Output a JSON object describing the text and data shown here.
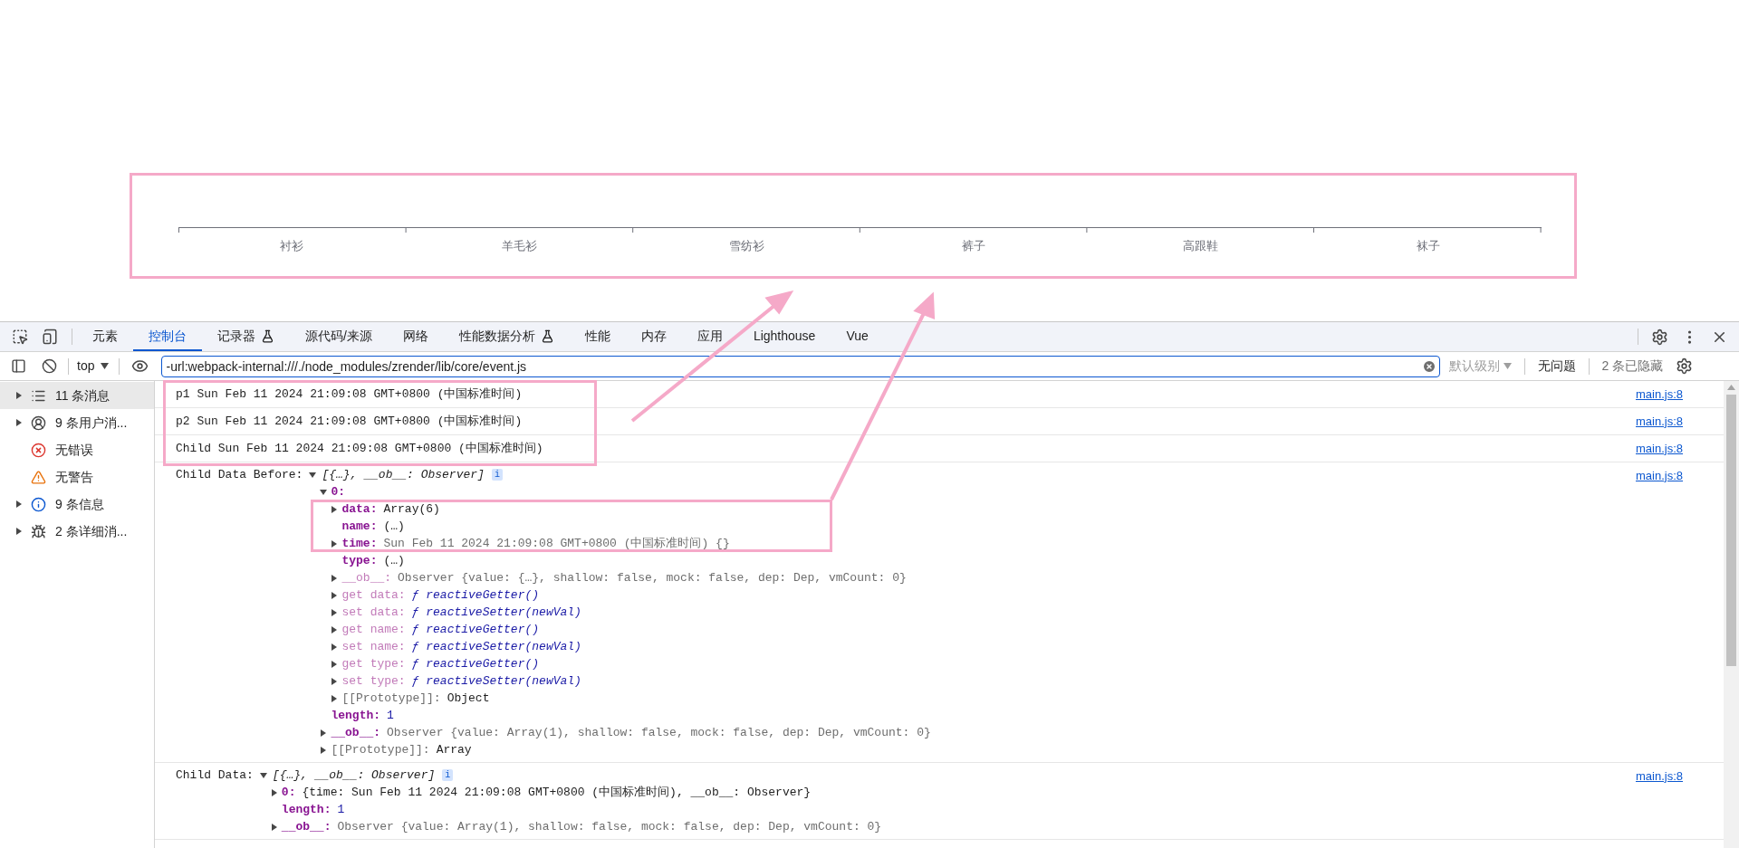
{
  "page": {
    "chart": {
      "categories": [
        "衬衫",
        "羊毛衫",
        "雪纺衫",
        "裤子",
        "高跟鞋",
        "袜子"
      ]
    }
  },
  "devtools": {
    "tabs": [
      {
        "label": "元素",
        "selected": false,
        "experimental": false
      },
      {
        "label": "控制台",
        "selected": true,
        "experimental": false
      },
      {
        "label": "记录器",
        "selected": false,
        "experimental": true
      },
      {
        "label": "源代码/来源",
        "selected": false,
        "experimental": false
      },
      {
        "label": "网络",
        "selected": false,
        "experimental": false
      },
      {
        "label": "性能数据分析",
        "selected": false,
        "experimental": true
      },
      {
        "label": "性能",
        "selected": false,
        "experimental": false
      },
      {
        "label": "内存",
        "selected": false,
        "experimental": false
      },
      {
        "label": "应用",
        "selected": false,
        "experimental": false
      },
      {
        "label": "Lighthouse",
        "selected": false,
        "experimental": false
      },
      {
        "label": "Vue",
        "selected": false,
        "experimental": false
      }
    ],
    "toolbar": {
      "context": "top",
      "filter": {
        "value": "-url:webpack-internal:///./node_modules/zrender/lib/core/event.js"
      },
      "level": "默认级别",
      "issues": "无问题",
      "hidden": "2 条已隐藏"
    },
    "sidebar": [
      {
        "label": "11 条消息",
        "kind": "messages",
        "expandable": true,
        "selected": true
      },
      {
        "label": "9 条用户消...",
        "kind": "user",
        "expandable": true,
        "selected": false
      },
      {
        "label": "无错误",
        "kind": "error",
        "expandable": false,
        "selected": false
      },
      {
        "label": "无警告",
        "kind": "warning",
        "expandable": false,
        "selected": false
      },
      {
        "label": "9 条信息",
        "kind": "info",
        "expandable": true,
        "selected": false
      },
      {
        "label": "2 条详细消...",
        "kind": "verbose",
        "expandable": true,
        "selected": false
      }
    ],
    "messages": [
      {
        "kind": "text",
        "text": "p1 Sun Feb 11 2024 21:09:08 GMT+0800 (中国标准时间)",
        "source": "main.js:8"
      },
      {
        "kind": "text",
        "text": "p2 Sun Feb 11 2024 21:09:08 GMT+0800 (中国标准时间)",
        "source": "main.js:8"
      },
      {
        "kind": "text",
        "text": "Child Sun Feb 11 2024 21:09:08 GMT+0800 (中国标准时间)",
        "source": "main.js:8"
      },
      {
        "kind": "object",
        "label": "Child Data Before:",
        "summary": "[{…}, __ob__: Observer]",
        "badge": "i",
        "expanded": true,
        "source": "main.js:8",
        "children": [
          {
            "key": "0:",
            "enumerable": true,
            "internal": false,
            "expandable": true,
            "expanded": true,
            "children": [
              {
                "kind": "text",
                "key": "data:",
                "enumerable": true,
                "internal": false,
                "value": "Array(6)",
                "expandable": true,
                "expanded": false
              },
              {
                "kind": "text",
                "key": "name:",
                "enumerable": true,
                "internal": false,
                "value": "(…)",
                "expandable": false
              },
              {
                "kind": "preview",
                "key": "time:",
                "enumerable": true,
                "internal": false,
                "value": "Sun Feb 11 2024 21:09:08 GMT+0800 (中国标准时间) {}",
                "expandable": true,
                "expanded": false
              },
              {
                "kind": "text",
                "key": "type:",
                "enumerable": true,
                "internal": false,
                "value": "(…)",
                "expandable": false
              },
              {
                "kind": "preview",
                "key": "__ob__:",
                "enumerable": false,
                "internal": false,
                "value": "Observer {value: {…}, shallow: false, mock: false, dep: Dep, vmCount: 0}",
                "expandable": true,
                "expanded": false
              },
              {
                "kind": "function",
                "key": "get data:",
                "enumerable": false,
                "internal": false,
                "value": "ƒ reactiveGetter()",
                "expandable": true,
                "expanded": false
              },
              {
                "kind": "function",
                "key": "set data:",
                "enumerable": false,
                "internal": false,
                "value": "ƒ reactiveSetter(newVal)",
                "expandable": true,
                "expanded": false
              },
              {
                "kind": "function",
                "key": "get name:",
                "enumerable": false,
                "internal": false,
                "value": "ƒ reactiveGetter()",
                "expandable": true,
                "expanded": false
              },
              {
                "kind": "function",
                "key": "set name:",
                "enumerable": false,
                "internal": false,
                "value": "ƒ reactiveSetter(newVal)",
                "expandable": true,
                "expanded": false
              },
              {
                "kind": "function",
                "key": "get type:",
                "enumerable": false,
                "internal": false,
                "value": "ƒ reactiveGetter()",
                "expandable": true,
                "expanded": false
              },
              {
                "kind": "function",
                "key": "set type:",
                "enumerable": false,
                "internal": false,
                "value": "ƒ reactiveSetter(newVal)",
                "expandable": true,
                "expanded": false
              },
              {
                "kind": "text",
                "key": "[[Prototype]]:",
                "enumerable": false,
                "internal": true,
                "value": "Object",
                "expandable": true,
                "expanded": false
              }
            ]
          },
          {
            "kind": "number",
            "key": "length:",
            "enumerable": true,
            "internal": false,
            "value": "1",
            "expandable": false
          },
          {
            "kind": "preview",
            "key": "__ob__:",
            "enumerable": true,
            "internal": false,
            "value": "Observer {value: Array(1), shallow: false, mock: false, dep: Dep, vmCount: 0}",
            "expandable": true,
            "expanded": false
          },
          {
            "kind": "text",
            "key": "[[Prototype]]:",
            "enumerable": false,
            "internal": true,
            "value": "Array",
            "expandable": true,
            "expanded": false
          }
        ]
      },
      {
        "kind": "object",
        "label": "Child Data:",
        "summary": "[{…}, __ob__: Observer]",
        "badge": "i",
        "expanded": true,
        "source": "main.js:8",
        "children": [
          {
            "kind": "text",
            "key": "0:",
            "enumerable": true,
            "internal": false,
            "value": "{time: Sun Feb 11 2024 21:09:08 GMT+0800 (中国标准时间), __ob__: Observer}",
            "expandable": true,
            "expanded": false
          },
          {
            "kind": "number",
            "key": "length:",
            "enumerable": true,
            "internal": false,
            "value": "1",
            "expandable": false
          },
          {
            "kind": "preview",
            "key": "__ob__:",
            "enumerable": true,
            "internal": false,
            "value": "Observer {value: Array(1), shallow: false, mock: false, dep: Dep, vmCount: 0}",
            "expandable": true,
            "expanded": false
          }
        ]
      }
    ]
  }
}
